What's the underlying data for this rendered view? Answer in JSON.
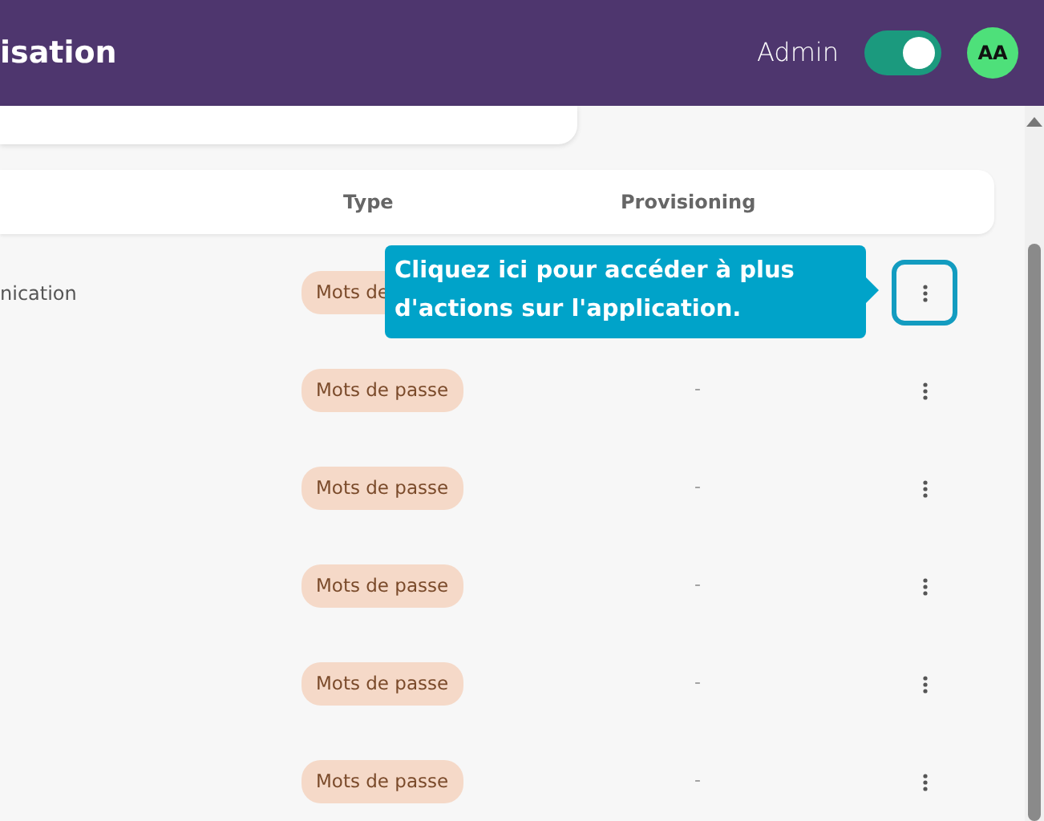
{
  "header": {
    "title": "isation",
    "role_label": "Admin",
    "admin_toggle": {
      "on": true
    },
    "avatar": "AA"
  },
  "table": {
    "columns": [
      "Type",
      "Provisioning"
    ],
    "rows": [
      {
        "name": "nication",
        "type": "Mots de",
        "provisioning": null,
        "highlighted": true
      },
      {
        "name": null,
        "type": "Mots de passe",
        "provisioning": "-",
        "highlighted": false
      },
      {
        "name": null,
        "type": "Mots de passe",
        "provisioning": "-",
        "highlighted": false
      },
      {
        "name": null,
        "type": "Mots de passe",
        "provisioning": "-",
        "highlighted": false
      },
      {
        "name": null,
        "type": "Mots de passe",
        "provisioning": "-",
        "highlighted": false
      },
      {
        "name": null,
        "type": "Mots de passe",
        "provisioning": "-",
        "highlighted": false
      }
    ]
  },
  "tooltip": {
    "text": "Cliquez ici pour accéder à plus d'actions sur l'application."
  }
}
